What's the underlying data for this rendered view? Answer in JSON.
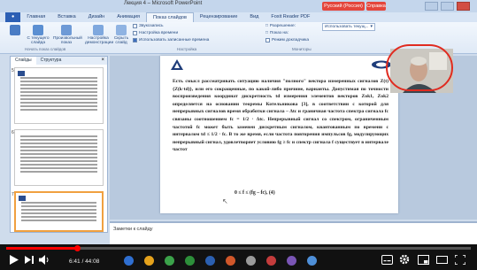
{
  "window": {
    "title": "Лекция 4 – Microsoft PowerPoint",
    "lang_badge": "Русский (Россия)",
    "help_label": "Справка"
  },
  "ribbon": {
    "tabs": [
      "",
      "Главная",
      "Вставка",
      "Дизайн",
      "Анимация",
      "Показ слайдов",
      "Рецензирование",
      "Вид",
      "Foxit Reader PDF"
    ],
    "active_tab_index": 5,
    "buttons": [
      {
        "label": "С текущего слайда"
      },
      {
        "label": "Произвольный показ"
      },
      {
        "label": "Настройка демонстрации"
      },
      {
        "label": "Скрыть слайд"
      }
    ],
    "options": [
      {
        "label": "Звукозапись",
        "checked": false
      },
      {
        "label": "Настройка времени",
        "checked": false
      },
      {
        "label": "Использовать записанные времена",
        "checked": true
      }
    ],
    "display": {
      "resolution_label": "Разрешение:",
      "show_on_label": "Показ на:",
      "presenter_label": "Режим докладчика",
      "dropdown_value": "Использовать текущ..."
    },
    "group_labels": [
      "Начать показ слайдов",
      "Настройка",
      "Мониторы"
    ]
  },
  "panel": {
    "tabs": [
      "Слайды",
      "Структура"
    ],
    "slide_numbers": [
      "5",
      "6",
      "7"
    ]
  },
  "slide": {
    "body": "Есть смысл рассматривать ситуацию наличия \"полного\" вектора измеренных сигналов Z(t){Z(k·td)}, или его сокращенные, по какой-либо причине, варианты. Допустимая по точности воспроизведения координат дискретность td измерения элементов векторов Zok1, Zok2 определяется на основании теоремы Котельникова [3], в соответствии с которой для непрерывных сигналов время обработки сигнала – Δtс и граничная частота спектра сигнала fc связаны соотношением fc = 1/2 · Δtс. Непрерывный сигнал со спектром, ограниченным частотой fc может быть заменен дискретным сигналом, квантованным по времени с интервалом td ≤ 1/2 · fc. В то же время, если частота повторения импульсов fg, модулирующих непрерывный сигнал, удовлетворяет условию fg ≥ fc и спектр сигнала f существует в интервале частот",
    "formula": "0 ≤ f ≤ (fg – fc),                    (4)"
  },
  "notes": {
    "placeholder": "Заметки к слайду"
  },
  "player": {
    "time": "6:41 / 44:08",
    "progress": 0.1515,
    "accent": "#ff0000"
  },
  "colors": {
    "ribbon_bg": "#dfe9f6",
    "editor_bg": "#b8c9de",
    "highlight_circle": "#e02b20"
  }
}
